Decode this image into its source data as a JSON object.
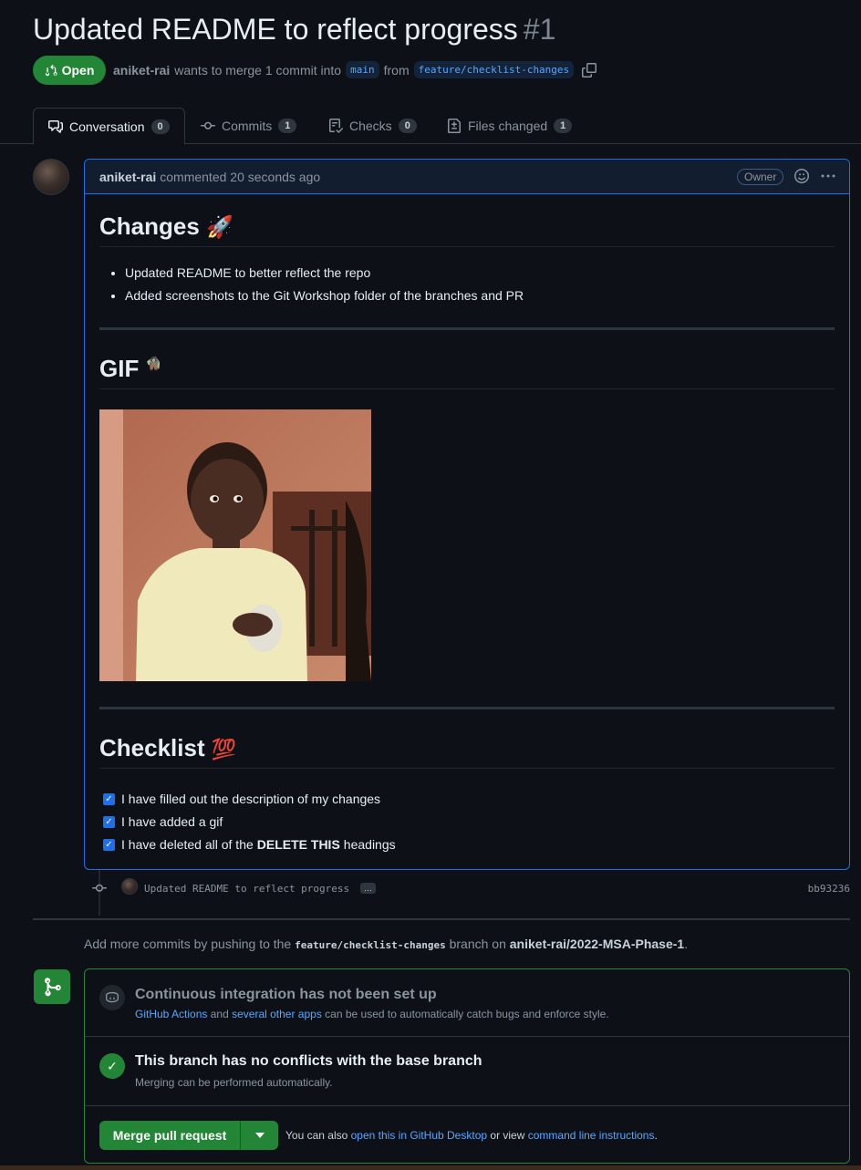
{
  "pr": {
    "title": "Updated README to reflect progress",
    "number": "#1",
    "state": "Open",
    "author": "aniket-rai",
    "merge_text": "wants to merge 1 commit into",
    "base_branch": "main",
    "from_text": "from",
    "head_branch": "feature/checklist-changes"
  },
  "tabs": [
    {
      "label": "Conversation",
      "count": "0"
    },
    {
      "label": "Commits",
      "count": "1"
    },
    {
      "label": "Checks",
      "count": "0"
    },
    {
      "label": "Files changed",
      "count": "1"
    }
  ],
  "comment": {
    "author": "aniket-rai",
    "action": "commented 20 seconds ago",
    "role_badge": "Owner",
    "changes_heading": "Changes",
    "changes_emoji": "🚀",
    "changes_items": [
      "Updated README to better reflect the repo",
      "Added screenshots to the Git Workshop folder of the branches and PR"
    ],
    "gif_heading": "GIF",
    "gif_emoji": "🧌",
    "checklist_heading": "Checklist",
    "checklist_emoji": "💯",
    "checklist_items": [
      {
        "text": "I have filled out the description of my changes",
        "checked": true
      },
      {
        "text": "I have added a gif",
        "checked": true
      },
      {
        "text_before": "I have deleted all of the",
        "bold": "DELETE THIS",
        "text_after": "headings",
        "checked": true
      }
    ]
  },
  "commit": {
    "message": "Updated README to reflect progress",
    "ellipsis": "…",
    "sha": "bb93236"
  },
  "push_hint": {
    "prefix": "Add more commits by pushing to the",
    "branch": "feature/checklist-changes",
    "middle": "branch on",
    "repo": "aniket-rai/2022-MSA-Phase-1",
    "suffix": "."
  },
  "merge": {
    "ci_title": "Continuous integration has not been set up",
    "ci_link1": "GitHub Actions",
    "ci_and": "and",
    "ci_link2": "several other apps",
    "ci_rest": "can be used to automatically catch bugs and enforce style.",
    "conflict_title": "This branch has no conflicts with the base branch",
    "conflict_sub": "Merging can be performed automatically.",
    "button_label": "Merge pull request",
    "note_prefix": "You can also",
    "note_link1": "open this in GitHub Desktop",
    "note_mid": "or view",
    "note_link2": "command line instructions",
    "note_suffix": "."
  },
  "colors": {
    "accent_green": "#238636",
    "link_blue": "#58a6ff",
    "border_blue": "#1f6feb",
    "background": "#0d1117"
  },
  "icons": [
    "pull-request-icon",
    "copy-icon",
    "conversation-icon",
    "commit-icon",
    "checks-icon",
    "diff-icon",
    "smiley-icon",
    "kebab-icon",
    "robot-icon",
    "check-icon",
    "merge-icon",
    "triangle-down-icon"
  ]
}
